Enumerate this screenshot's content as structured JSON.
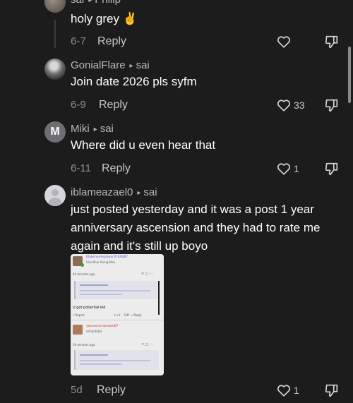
{
  "comments": [
    {
      "user": "sai",
      "reply_to": "Philip",
      "text": "holy grey",
      "emoji": "✌️",
      "date": "6-7",
      "reply_label": "Reply",
      "likes": ""
    },
    {
      "user": "GonialFlare",
      "reply_to": "sai",
      "text": "Join date 2026 pls syfm",
      "date": "6-9",
      "reply_label": "Reply",
      "likes": "33"
    },
    {
      "user": "Miki",
      "avatar_letter": "M",
      "reply_to": "sai",
      "text": "Where did u even hear that",
      "date": "6-11",
      "reply_label": "Reply",
      "likes": "1"
    },
    {
      "user": "iblameazael0",
      "reply_to": "sai",
      "text": "just posted yesterday and it was a post 1 year anniversary ascension and they had to rate me again and it's still up boyo",
      "date": "5d",
      "reply_label": "Reply",
      "likes": "1"
    }
  ],
  "attached_image": {
    "user1": "blakenameplayer3749287",
    "user1_sub": "Sensitive Young Man",
    "time1": "40 minutes ago",
    "comment": "U got potential kid",
    "report": "Report",
    "plus1": "+1",
    "gift": "Gift",
    "reply": "Reply",
    "user2": "yourassomissezel67",
    "user2_sub": "infraorbital",
    "time2": "39 minutes ago"
  },
  "colors": {
    "background": "#1c1c1c",
    "text": "#ffffff",
    "muted": "#8d8d8d",
    "link": "#4a5fd6"
  }
}
